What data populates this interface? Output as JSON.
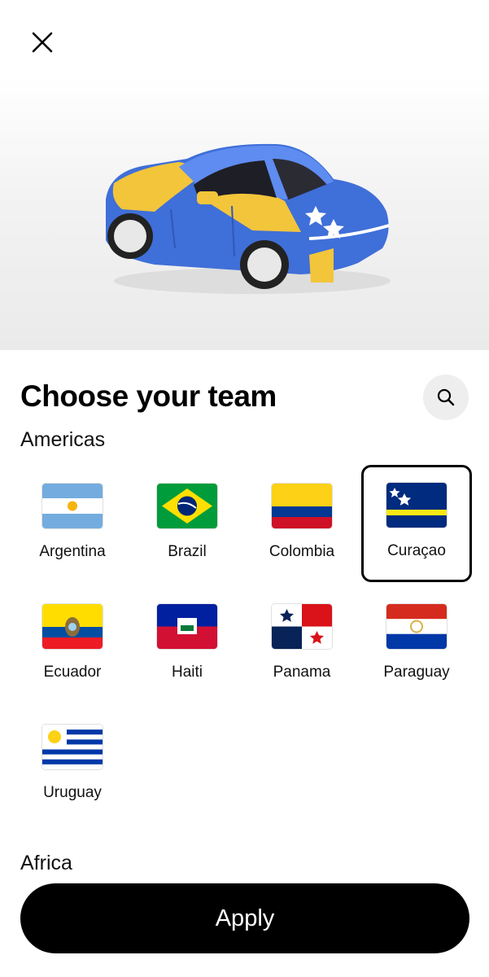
{
  "header": {
    "close_icon": "close-icon"
  },
  "hero": {
    "car_colors": {
      "body": "#3f6fd8",
      "stripe": "#f2c53b"
    }
  },
  "main": {
    "title": "Choose your team",
    "search_icon": "search-icon",
    "sections": [
      {
        "label": "Americas",
        "teams": [
          {
            "name": "Argentina",
            "selected": false
          },
          {
            "name": "Brazil",
            "selected": false
          },
          {
            "name": "Colombia",
            "selected": false
          },
          {
            "name": "Curaçao",
            "selected": true
          },
          {
            "name": "Ecuador",
            "selected": false
          },
          {
            "name": "Haiti",
            "selected": false
          },
          {
            "name": "Panama",
            "selected": false
          },
          {
            "name": "Paraguay",
            "selected": false
          },
          {
            "name": "Uruguay",
            "selected": false
          }
        ]
      },
      {
        "label": "Africa",
        "teams": []
      }
    ]
  },
  "footer": {
    "apply_label": "Apply"
  },
  "colors": {
    "primary_button": "#000000",
    "selection_border": "#000000"
  }
}
